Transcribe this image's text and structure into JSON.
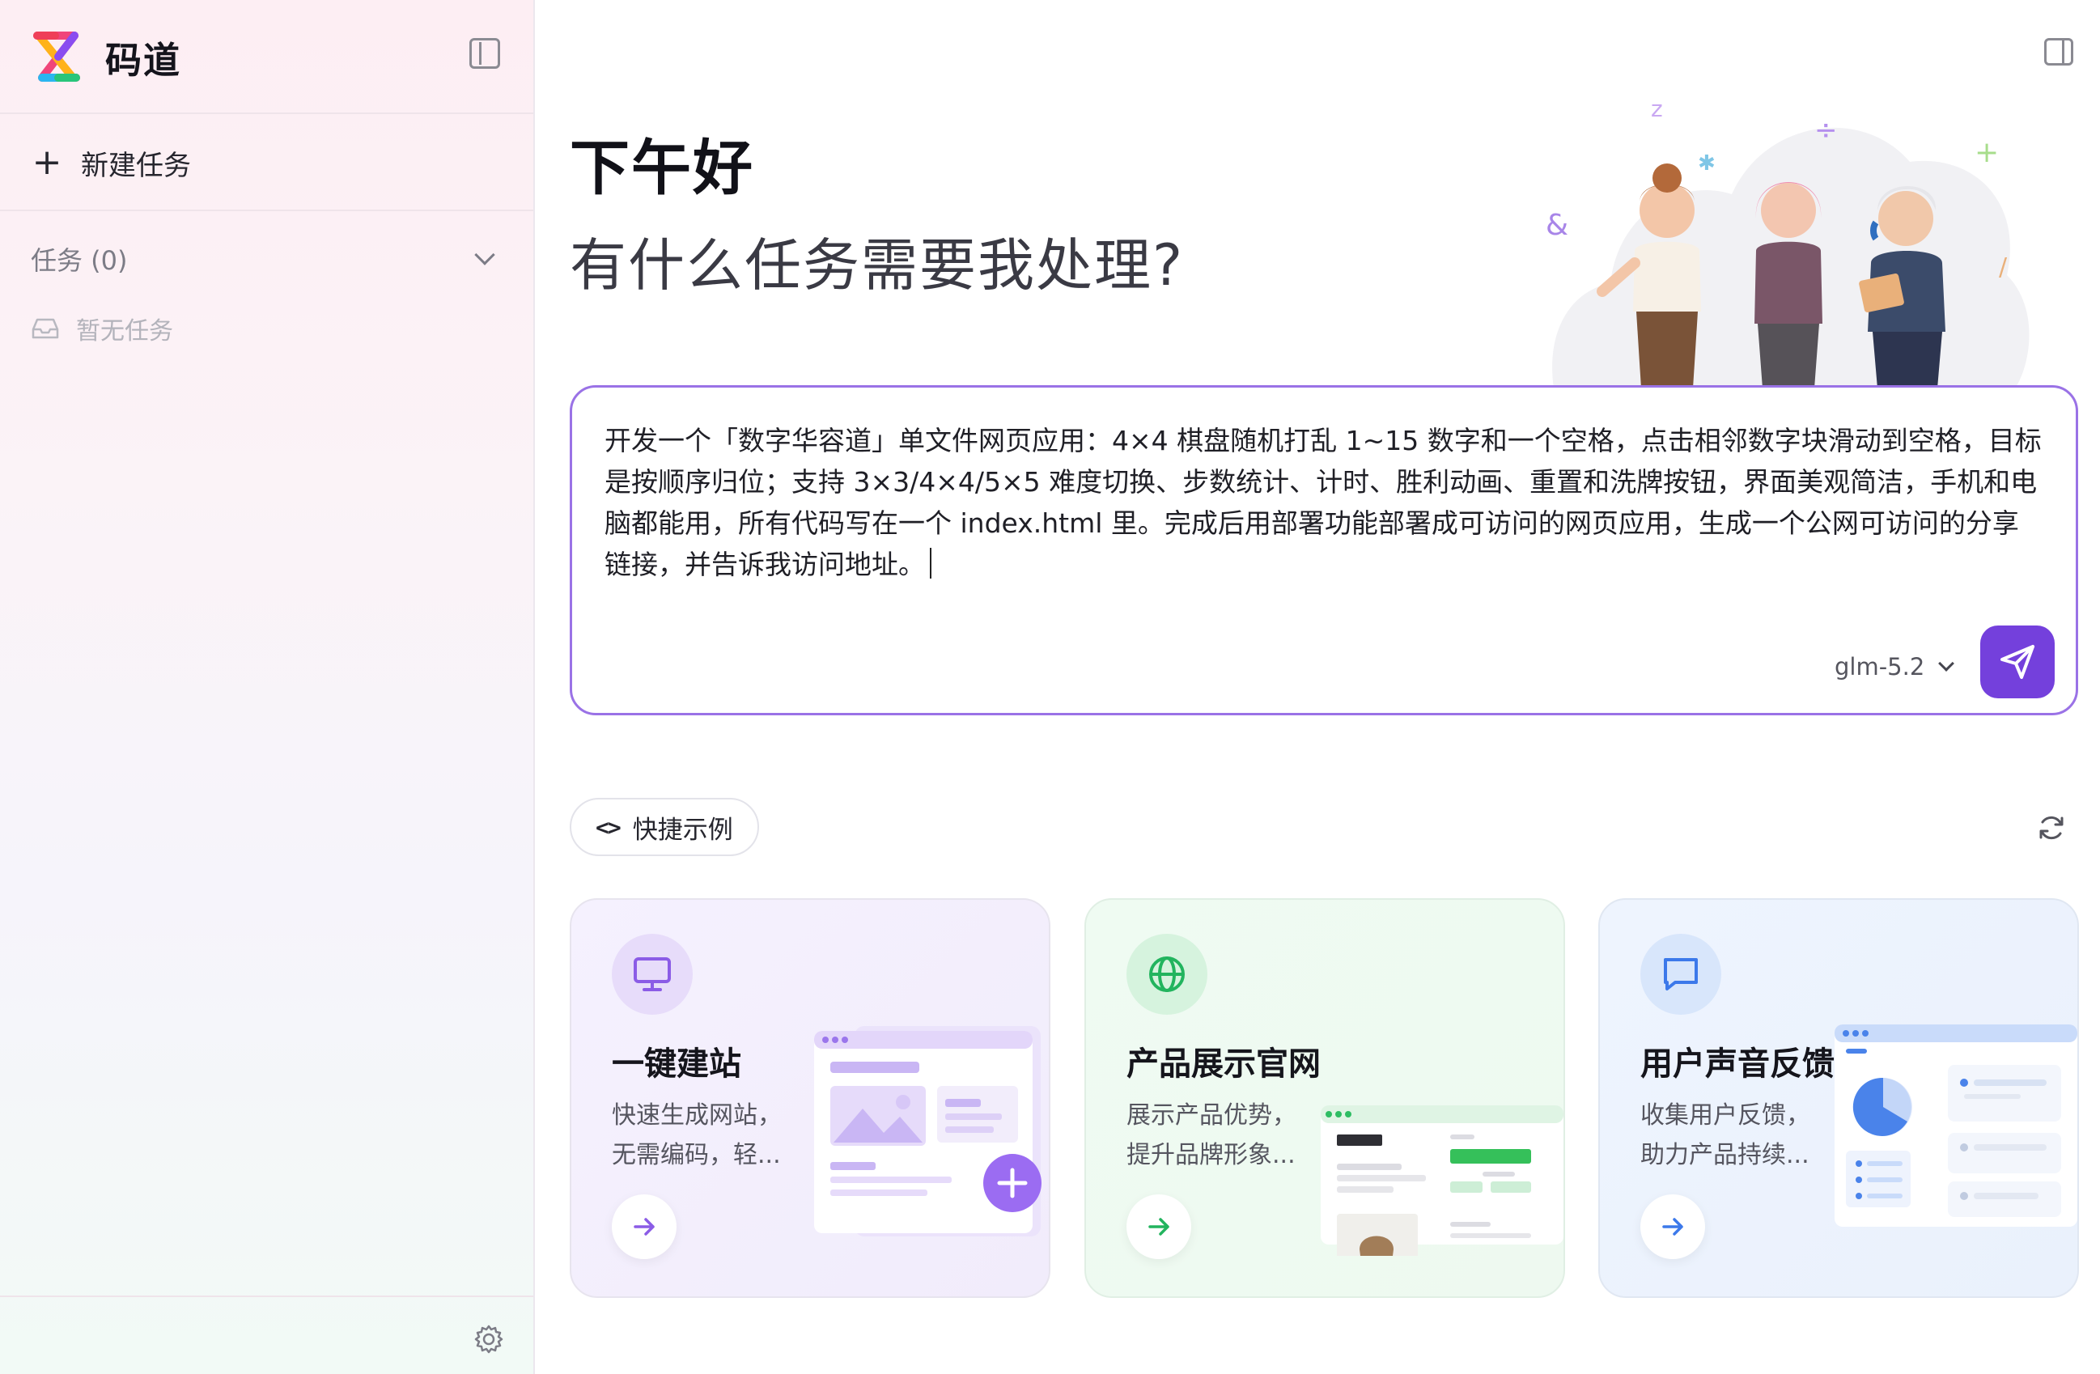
{
  "app": {
    "name": "码道"
  },
  "sidebar": {
    "new_task_label": "新建任务",
    "tasks_title": "任务 (0)",
    "empty_label": "暂无任务"
  },
  "main": {
    "greeting": "下午好",
    "subtitle": "有什么任务需要我处理?",
    "prompt": {
      "text": "开发一个「数字华容道」单文件网页应用：4×4 棋盘随机打乱 1~15 数字和一个空格，点击相邻数字块滑动到空格，目标是按顺序归位；支持 3×3/4×4/5×5 难度切换、步数统计、计时、胜利动画、重置和洗牌按钮，界面美观简洁，手机和电脑都能用，所有代码写在一个 index.html 里。完成后用部署功能部署成可访问的网页应用，生成一个公网可访问的分享链接，并告诉我访问地址。",
      "model": "glm-5.2"
    },
    "quick_examples_label": "快捷示例",
    "cards": [
      {
        "title": "一键建站",
        "desc_line1": "快速生成网站，",
        "desc_line2": "无需编码，轻...",
        "icon": "monitor-icon"
      },
      {
        "title": "产品展示官网",
        "desc_line1": "展示产品优势，",
        "desc_line2": "提升品牌形象...",
        "icon": "globe-icon"
      },
      {
        "title": "用户声音反馈",
        "desc_line1": "收集用户反馈，",
        "desc_line2": "助力产品持续...",
        "icon": "message-icon"
      }
    ]
  },
  "colors": {
    "accent": "#7440dc",
    "prompt_border": "#9a72e6",
    "card_purple": "#f4f0fd",
    "card_green": "#eefaf1",
    "card_blue": "#edf3fd"
  }
}
